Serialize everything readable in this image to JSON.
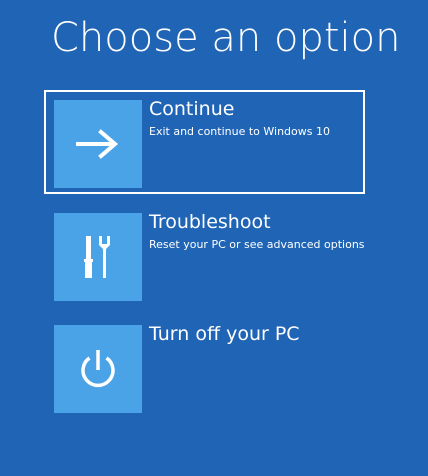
{
  "page": {
    "title": "Choose an option"
  },
  "options": [
    {
      "label": "Continue",
      "description": "Exit and continue to Windows 10",
      "icon": "arrow-right-icon",
      "selected": true
    },
    {
      "label": "Troubleshoot",
      "description": "Reset your PC or see advanced options",
      "icon": "tools-icon",
      "selected": false
    },
    {
      "label": "Turn off your PC",
      "description": "",
      "icon": "power-icon",
      "selected": false
    }
  ],
  "colors": {
    "background": "#1f64b5",
    "tile": "#4aa3e6",
    "text": "#ffffff"
  }
}
